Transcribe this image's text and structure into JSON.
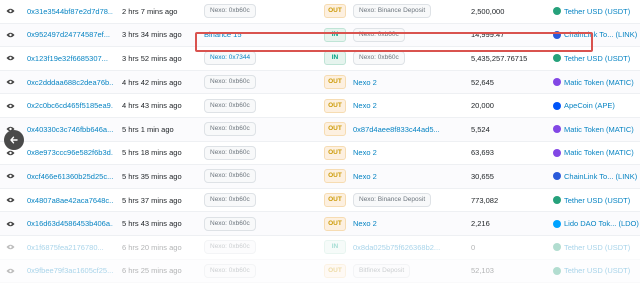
{
  "rows": [
    {
      "hash": "0x31e3544bf87e2d7d78...",
      "age": "2 hrs 7 mins ago",
      "from": "Nexo: 0xb60c",
      "from_style": "pill",
      "dir": "OUT",
      "to": "Nexo: Binance Deposit",
      "to_style": "pill",
      "qty": "2,500,000",
      "token": "Tether USD (USDT)",
      "token_color": "#26a17b"
    },
    {
      "hash": "0x952497d24774587ef...",
      "age": "3 hrs 34 mins ago",
      "from": "Binance 15",
      "from_style": "link",
      "dir": "IN",
      "to": "Nexo: 0xb60c",
      "to_style": "pill",
      "qty": "14,999.47",
      "token": "ChainLink To... (LINK)",
      "token_color": "#2a5ada"
    },
    {
      "hash": "0x123f19e32f6685307...",
      "age": "3 hrs 52 mins ago",
      "from": "Nexo: 0x7344",
      "from_style": "pill-link",
      "dir": "IN",
      "to": "Nexo: 0xb60c",
      "to_style": "pill",
      "qty": "5,435,257.76715",
      "token": "Tether USD (USDT)",
      "token_color": "#26a17b"
    },
    {
      "hash": "0xc2dddaa688c2dea76b...",
      "age": "4 hrs 42 mins ago",
      "from": "Nexo: 0xb60c",
      "from_style": "pill",
      "dir": "OUT",
      "to": "Nexo 2",
      "to_style": "link",
      "qty": "52,645",
      "token": "Matic Token (MATIC)",
      "token_color": "#8247e5"
    },
    {
      "hash": "0x2c0bc6cd465f5185ea9...",
      "age": "4 hrs 43 mins ago",
      "from": "Nexo: 0xb60c",
      "from_style": "pill",
      "dir": "OUT",
      "to": "Nexo 2",
      "to_style": "link",
      "qty": "20,000",
      "token": "ApeCoin (APE)",
      "token_color": "#0054f9"
    },
    {
      "hash": "0x40330c3c746fbb646a...",
      "age": "5 hrs 1 min ago",
      "from": "Nexo: 0xb60c",
      "from_style": "pill",
      "dir": "OUT",
      "to": "0x87d4aee8f833c44ad5...",
      "to_style": "link",
      "qty": "5,524",
      "token": "Matic Token (MATIC)",
      "token_color": "#8247e5"
    },
    {
      "hash": "0x8e973ccc96e582f6b3d...",
      "age": "5 hrs 18 mins ago",
      "from": "Nexo: 0xb60c",
      "from_style": "pill",
      "dir": "OUT",
      "to": "Nexo 2",
      "to_style": "link",
      "qty": "63,693",
      "token": "Matic Token (MATIC)",
      "token_color": "#8247e5"
    },
    {
      "hash": "0xcf466e61360b25d25c...",
      "age": "5 hrs 35 mins ago",
      "from": "Nexo: 0xb60c",
      "from_style": "pill",
      "dir": "OUT",
      "to": "Nexo 2",
      "to_style": "link",
      "qty": "30,655",
      "token": "ChainLink To... (LINK)",
      "token_color": "#2a5ada"
    },
    {
      "hash": "0x4807a8ae42aca7648c...",
      "age": "5 hrs 37 mins ago",
      "from": "Nexo: 0xb60c",
      "from_style": "pill",
      "dir": "OUT",
      "to": "Nexo: Binance Deposit",
      "to_style": "pill",
      "qty": "773,082",
      "token": "Tether USD (USDT)",
      "token_color": "#26a17b"
    },
    {
      "hash": "0x16d63d4586453b406a...",
      "age": "5 hrs 43 mins ago",
      "from": "Nexo: 0xb60c",
      "from_style": "pill",
      "dir": "OUT",
      "to": "Nexo 2",
      "to_style": "link",
      "qty": "2,216",
      "token": "Lido DAO Tok... (LDO)",
      "token_color": "#00a3ff"
    },
    {
      "hash": "0x1f6875fea2176780...",
      "age": "6 hrs 20 mins ago",
      "from": "Nexo: 0xb60c",
      "from_style": "pill",
      "dir": "IN",
      "to": "0x8da025b75f626368b2...",
      "to_style": "link",
      "qty": "0",
      "token": "Tether USD (USDT)",
      "token_color": "#26a17b",
      "faded": true
    },
    {
      "hash": "0x9fbee79f3ac1605cf25...",
      "age": "6 hrs 25 mins ago",
      "from": "Nexo: 0xb60c",
      "from_style": "pill",
      "dir": "OUT",
      "to": "Bitfinex Deposit",
      "to_style": "pill",
      "qty": "52,103",
      "token": "Tether USD (USDT)",
      "token_color": "#26a17b",
      "faded": true
    }
  ],
  "highlighted_row": 1
}
